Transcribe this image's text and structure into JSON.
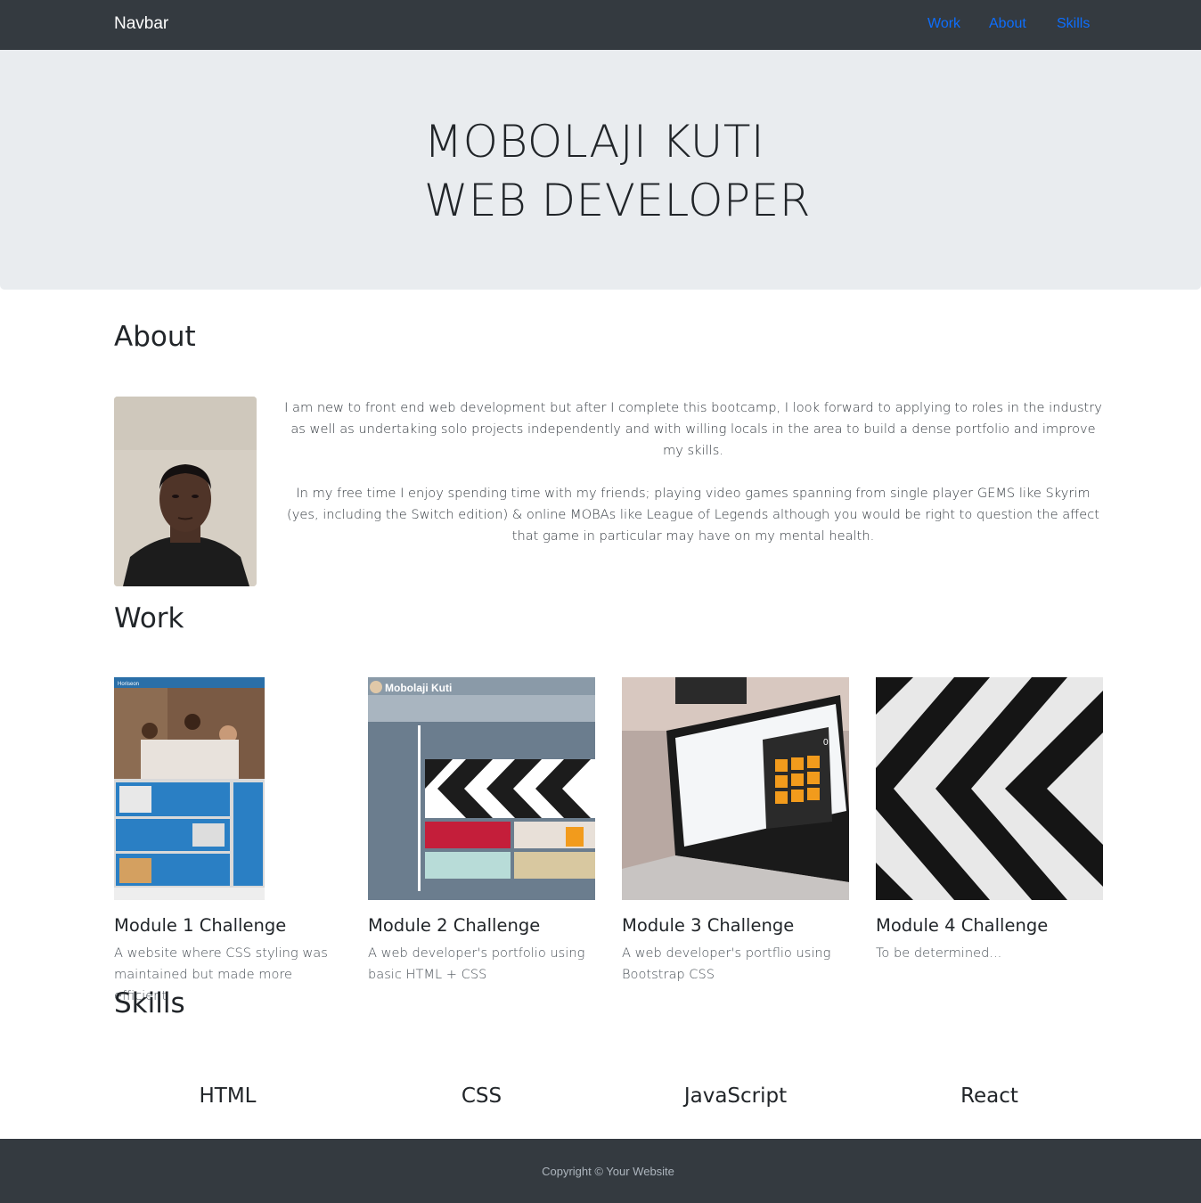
{
  "navbar": {
    "brand": "Navbar",
    "links": [
      "Work",
      "About",
      "Skills"
    ]
  },
  "hero": {
    "line1": "MOBOLAJI KUTI",
    "line2": "WEB DEVELOPER"
  },
  "about": {
    "heading": "About",
    "paragraphs": [
      "I am new to front end web development but after I complete this bootcamp, I look forward to applying to roles in the industry as well as undertaking solo projects independently and with willing locals in the area to build a dense portfolio and improve my skills.",
      "In my free time I enjoy spending time with my friends; playing video games spanning from single player GEMS like Skyrim (yes, including the Switch edition) & online MOBAs like League of Legends although you would be right to question the affect that game in particular may have on my mental health."
    ]
  },
  "work": {
    "heading": "Work",
    "cards": [
      {
        "title": "Module 1 Challenge",
        "text": "A website where CSS styling was maintained but made more efficient",
        "thumb_label": "Horiseon"
      },
      {
        "title": "Module 2 Challenge",
        "text": "A web developer's portfolio using basic HTML + CSS",
        "thumb_label": "Mobolaji Kuti"
      },
      {
        "title": "Module 3 Challenge",
        "text": "A web developer's portflio using Bootstrap CSS",
        "thumb_label": "0"
      },
      {
        "title": "Module 4 Challenge",
        "text": "To be determined...",
        "thumb_label": ""
      }
    ]
  },
  "skills": {
    "heading": "Skills",
    "items": [
      "HTML",
      "CSS",
      "JavaScript",
      "React"
    ]
  },
  "footer": {
    "text": "Copyright © Your Website"
  },
  "colors": {
    "navbar_bg": "#343a40",
    "link": "#0d6efd",
    "hero_bg": "#e9ecef",
    "footer_text": "#adb5bd"
  }
}
